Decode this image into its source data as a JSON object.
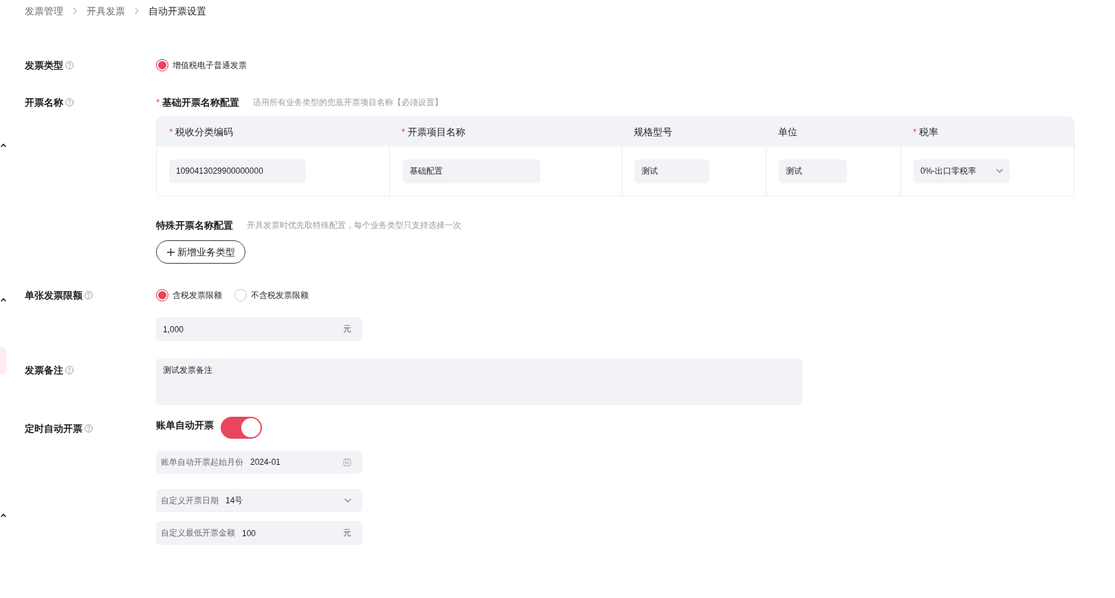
{
  "breadcrumb": [
    {
      "label": "发票管理",
      "current": false
    },
    {
      "label": "开具发票",
      "current": false
    },
    {
      "label": "自动开票设置",
      "current": true
    }
  ],
  "form": {
    "invoice_type": {
      "label": "发票类型",
      "options": [
        {
          "label": "增值税电子普通发票",
          "selected": true
        }
      ]
    },
    "invoice_name": {
      "label": "开票名称",
      "base_config": {
        "required_mark": "*",
        "title": "基础开票名称配置",
        "hint": "适用所有业务类型的兜底开票项目名称【必须设置】"
      },
      "table": {
        "columns": [
          {
            "required_mark": "*",
            "label": "税收分类编码"
          },
          {
            "required_mark": "*",
            "label": "开票项目名称"
          },
          {
            "label": "规格型号"
          },
          {
            "label": "单位"
          },
          {
            "required_mark": "*",
            "label": "税率"
          }
        ],
        "rows": [
          {
            "cells": [
              {
                "kind": "input",
                "value": "1090413029900000000"
              },
              {
                "kind": "input",
                "value": "基础配置"
              },
              {
                "kind": "input",
                "value": "测试"
              },
              {
                "kind": "input",
                "value": "测试"
              },
              {
                "kind": "select",
                "value": "0%-出口零税率"
              }
            ]
          }
        ]
      },
      "special_config": {
        "title": "特殊开票名称配置",
        "hint": "开具发票时优先取特殊配置，每个业务类型只支持选择一次"
      },
      "add_button": {
        "label": "新增业务类型"
      }
    },
    "invoice_limit": {
      "label": "单张发票限额",
      "options": [
        {
          "label": "含税发票限额",
          "selected": true
        },
        {
          "label": "不含税发票限额",
          "selected": false
        }
      ],
      "amount": {
        "value": "1,000",
        "unit": "元"
      }
    },
    "remark": {
      "label": "发票备注",
      "value": "测试发票备注"
    },
    "auto_invoice": {
      "label": "定时自动开票",
      "switch": {
        "label": "账单自动开票",
        "on": true
      },
      "fields": [
        {
          "kind": "date",
          "label": "账单自动开票起始月份",
          "value": "2024-01"
        },
        {
          "kind": "select",
          "label": "自定义开票日期",
          "value": "14号"
        },
        {
          "kind": "amount",
          "label": "自定义最低开票金额",
          "value": "100",
          "unit": "元"
        }
      ]
    }
  }
}
